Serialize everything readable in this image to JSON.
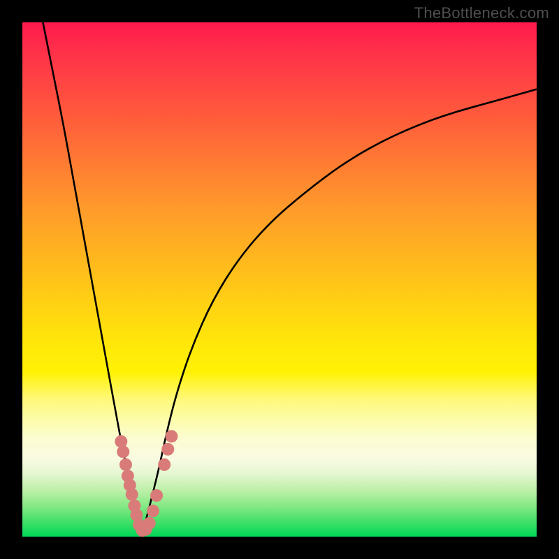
{
  "watermark": "TheBottleneck.com",
  "chart_data": {
    "type": "line",
    "title": "",
    "xlabel": "",
    "ylabel": "",
    "xlim": [
      0,
      100
    ],
    "ylim": [
      0,
      100
    ],
    "note": "Bottleneck mismatch curve. Two branches meeting at the optimal point (minimum bottleneck). Values are approximate percentages read off the figure geometry; the chart has no tick labels.",
    "series": [
      {
        "name": "left-branch",
        "x": [
          4,
          6,
          8,
          10,
          12,
          14,
          16,
          18,
          19.5,
          21,
          22,
          22.7,
          23.3
        ],
        "y": [
          100,
          90,
          80,
          69,
          58,
          47,
          36,
          25,
          17,
          10,
          6,
          3,
          1
        ]
      },
      {
        "name": "right-branch",
        "x": [
          23.3,
          24,
          25,
          26.5,
          28,
          30,
          33,
          37,
          42,
          48,
          55,
          63,
          72,
          82,
          93,
          100
        ],
        "y": [
          1,
          3,
          7,
          13,
          20,
          28,
          37,
          46,
          54,
          61,
          67,
          73,
          78,
          82,
          85,
          87
        ]
      }
    ],
    "optimal_point": {
      "x": 23.3,
      "y": 1
    },
    "highlight_clusters": [
      {
        "name": "left-cluster",
        "points": [
          {
            "x": 19.2,
            "y": 18.5
          },
          {
            "x": 19.6,
            "y": 16.5
          },
          {
            "x": 20.1,
            "y": 14.0
          },
          {
            "x": 20.5,
            "y": 11.8
          },
          {
            "x": 20.9,
            "y": 10.0
          },
          {
            "x": 21.3,
            "y": 8.2
          },
          {
            "x": 21.8,
            "y": 6.0
          },
          {
            "x": 22.2,
            "y": 4.2
          }
        ]
      },
      {
        "name": "bottom-cluster",
        "points": [
          {
            "x": 22.7,
            "y": 2.3
          },
          {
            "x": 23.3,
            "y": 1.2
          },
          {
            "x": 24.0,
            "y": 1.4
          },
          {
            "x": 24.7,
            "y": 2.6
          }
        ]
      },
      {
        "name": "right-cluster",
        "points": [
          {
            "x": 25.4,
            "y": 5.0
          },
          {
            "x": 26.1,
            "y": 8.0
          },
          {
            "x": 27.6,
            "y": 14.0
          },
          {
            "x": 28.3,
            "y": 17.0
          },
          {
            "x": 29.0,
            "y": 19.5
          }
        ]
      }
    ],
    "colors": {
      "curve": "#000000",
      "highlight": "#d97b78",
      "gradient_top": "#ff1a4d",
      "gradient_bottom": "#00d957"
    }
  }
}
